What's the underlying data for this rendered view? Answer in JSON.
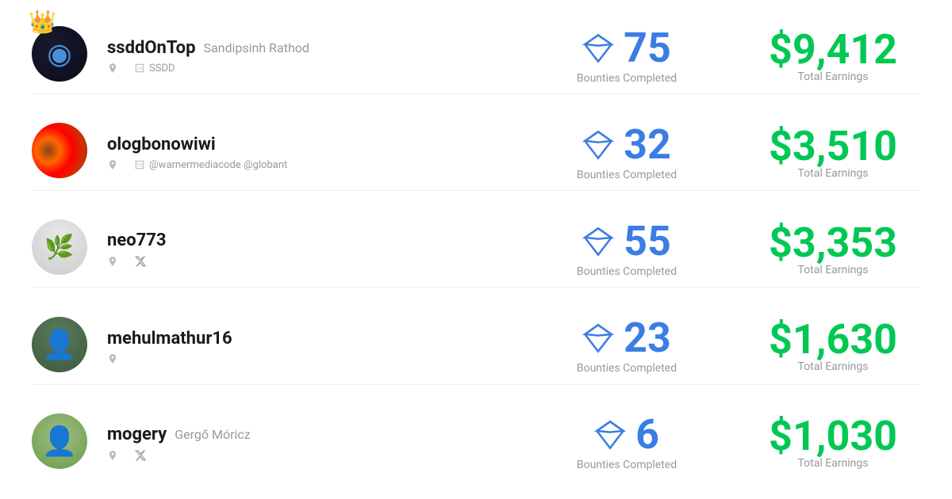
{
  "users": [
    {
      "id": "ssdd",
      "username": "ssddOnTop",
      "real_name": "Sandipsinh Rathod",
      "has_crown": true,
      "meta_location": "",
      "meta_org": "SSDD",
      "meta_twitter": "",
      "bounties": 75,
      "earnings": "$9,412",
      "avatar_class": "avatar-ssdd"
    },
    {
      "id": "olog",
      "username": "ologbonowiwi",
      "real_name": "",
      "has_crown": false,
      "meta_location": "",
      "meta_org": "@warnermediacode @globant",
      "meta_twitter": "",
      "bounties": 32,
      "earnings": "$3,510",
      "avatar_class": "avatar-olog"
    },
    {
      "id": "neo",
      "username": "neo773",
      "real_name": "",
      "has_crown": false,
      "meta_location": "",
      "meta_org": "",
      "meta_twitter": "twitter",
      "bounties": 55,
      "earnings": "$3,353",
      "avatar_class": "avatar-neo"
    },
    {
      "id": "mehul",
      "username": "mehulmathur16",
      "real_name": "",
      "has_crown": false,
      "meta_location": "",
      "meta_org": "",
      "meta_twitter": "",
      "bounties": 23,
      "earnings": "$1,630",
      "avatar_class": "avatar-mehul"
    },
    {
      "id": "mogery",
      "username": "mogery",
      "real_name": "Gergő Móricz",
      "has_crown": false,
      "meta_location": "",
      "meta_org": "",
      "meta_twitter": "twitter",
      "bounties": 6,
      "earnings": "$1,030",
      "avatar_class": "avatar-mogery"
    }
  ],
  "labels": {
    "bounties_completed": "Bounties Completed",
    "total_earnings": "Total Earnings"
  }
}
